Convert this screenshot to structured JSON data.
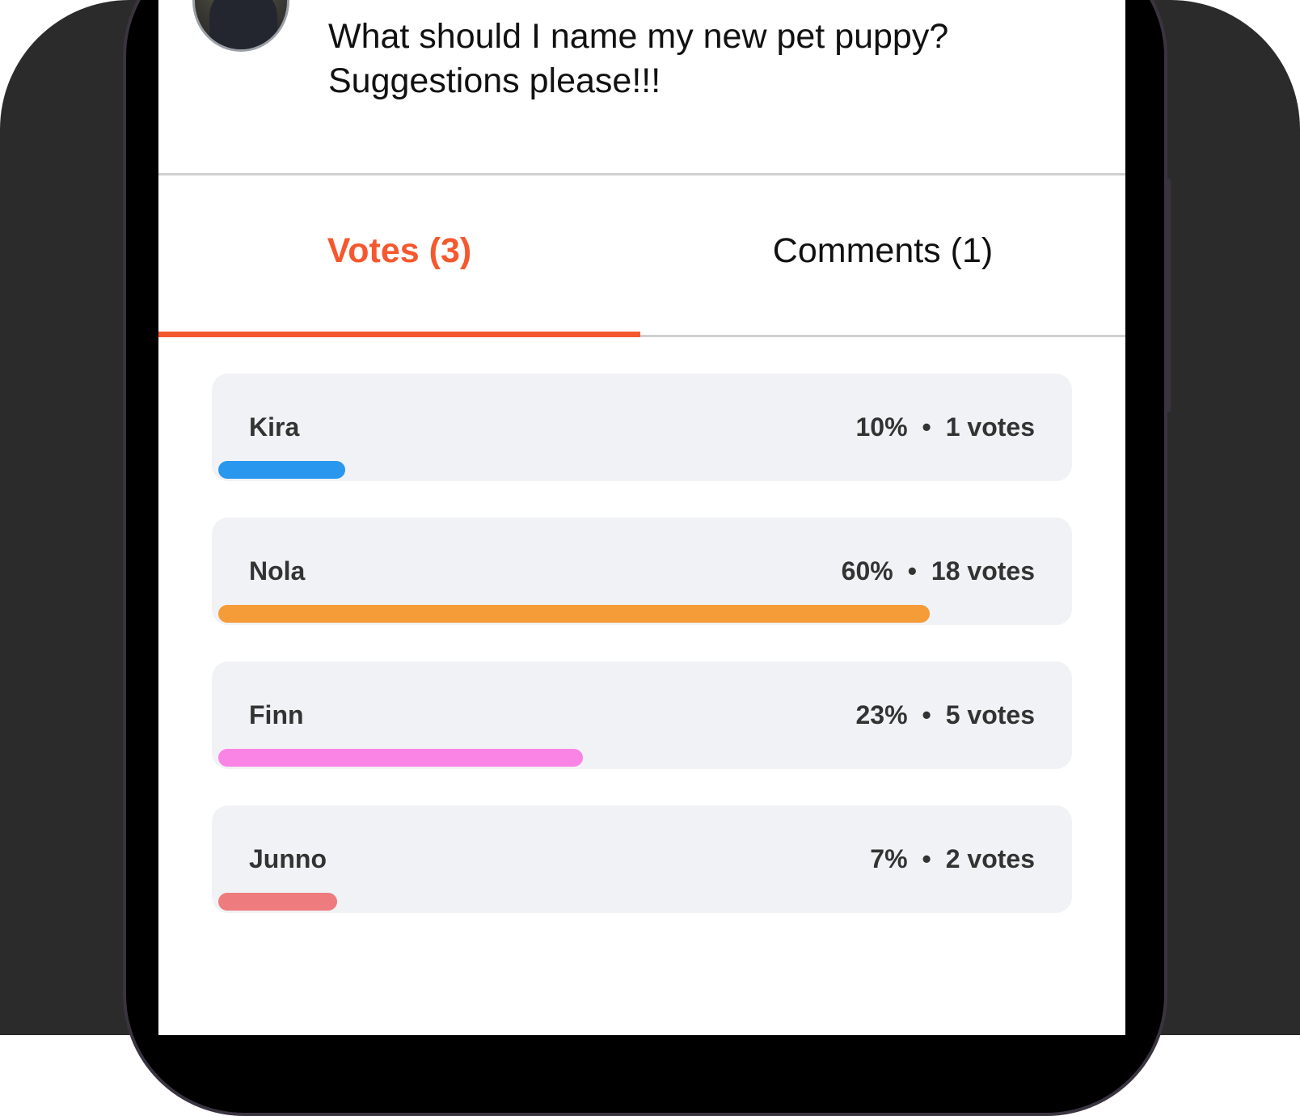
{
  "post": {
    "question": "What should I name my new pet puppy? Suggestions please!!!"
  },
  "tabs": [
    {
      "label": "Votes (3)",
      "active": true
    },
    {
      "label": "Comments (1)",
      "active": false
    }
  ],
  "colors": {
    "accent": "#f5582e"
  },
  "poll": {
    "options": [
      {
        "name": "Kira",
        "percent": "10%",
        "votes": "1 votes",
        "fraction": 0.15,
        "color": "#2a97ef"
      },
      {
        "name": "Nola",
        "percent": "60%",
        "votes": "18 votes",
        "fraction": 0.84,
        "color": "#f59b38"
      },
      {
        "name": "Finn",
        "percent": "23%",
        "votes": "5 votes",
        "fraction": 0.43,
        "color": "#f984e6"
      },
      {
        "name": "Junno",
        "percent": "7%",
        "votes": "2 votes",
        "fraction": 0.14,
        "color": "#ee7b7d"
      }
    ]
  }
}
